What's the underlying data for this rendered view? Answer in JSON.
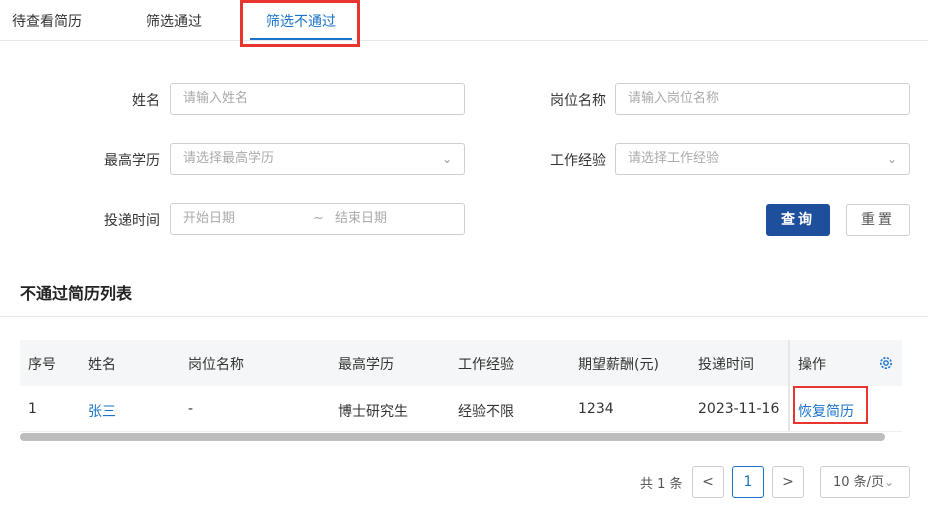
{
  "tabs": [
    "待查看简历",
    "筛选通过",
    "筛选不通过"
  ],
  "filters": {
    "name_label": "姓名",
    "name_placeholder": "请输入姓名",
    "position_label": "岗位名称",
    "position_placeholder": "请输入岗位名称",
    "education_label": "最高学历",
    "education_placeholder": "请选择最高学历",
    "experience_label": "工作经验",
    "experience_placeholder": "请选择工作经验",
    "date_label": "投递时间",
    "start_placeholder": "开始日期",
    "date_sep": "~",
    "end_placeholder": "结束日期",
    "query_button": "查询",
    "reset_button": "重置"
  },
  "list": {
    "title": "不通过简历列表",
    "columns": [
      "序号",
      "姓名",
      "岗位名称",
      "最高学历",
      "工作经验",
      "期望薪酬(元)",
      "投递时间",
      "操作"
    ],
    "rows": [
      {
        "index": "1",
        "name": "张三",
        "position": "-",
        "education": "博士研究生",
        "experience": "经验不限",
        "salary": "1234",
        "date": "2023-11-16",
        "action": "恢复简历"
      }
    ]
  },
  "pagination": {
    "total_text": "共 1 条",
    "prev": "<",
    "current": "1",
    "next": ">",
    "page_size": "10 条/页"
  },
  "colors": {
    "accent": "#1a73c9",
    "primary_button": "#1e4f9c",
    "highlight": "#e8352f"
  }
}
